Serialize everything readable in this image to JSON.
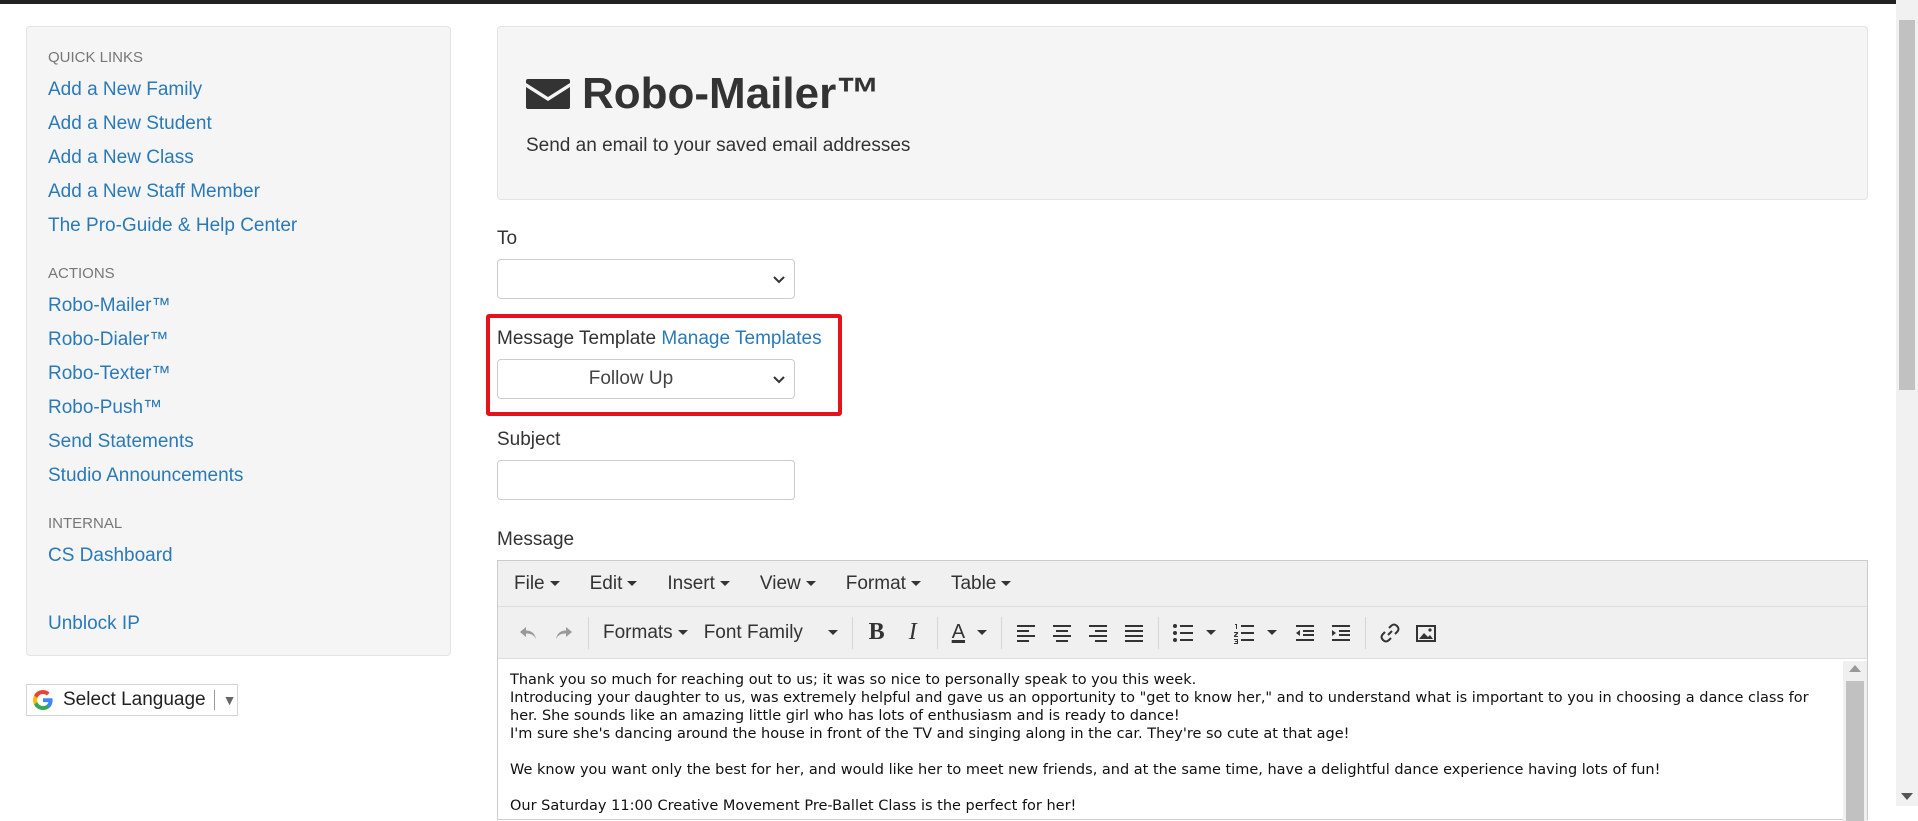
{
  "sidebar": {
    "sections": [
      {
        "heading": "QUICK LINKS",
        "links": [
          "Add a New Family",
          "Add a New Student",
          "Add a New Class",
          "Add a New Staff Member",
          "The Pro-Guide & Help Center"
        ]
      },
      {
        "heading": "ACTIONS",
        "links": [
          "Robo-Mailer™",
          "Robo-Dialer™",
          "Robo-Texter™",
          "Robo-Push™",
          "Send Statements",
          "Studio Announcements"
        ]
      },
      {
        "heading": "INTERNAL",
        "links": [
          "CS Dashboard"
        ]
      }
    ],
    "unblock": "Unblock IP"
  },
  "language": {
    "label": "Select Language",
    "arrow": "▼"
  },
  "header": {
    "title": "Robo-Mailer™",
    "subtitle": "Send an email to your saved email addresses"
  },
  "form": {
    "to_label": "To",
    "to_value": "",
    "template_label": "Message Template",
    "manage_link": "Manage Templates",
    "template_value": "Follow Up",
    "subject_label": "Subject",
    "subject_value": "",
    "message_label": "Message"
  },
  "editor": {
    "menus": [
      "File",
      "Edit",
      "Insert",
      "View",
      "Format",
      "Table"
    ],
    "toolbar": {
      "formats": "Formats",
      "font_family": "Font Family",
      "bold": "B",
      "italic": "I",
      "color": "A"
    },
    "content": [
      "Thank you so much for reaching out to us; it was so nice to personally speak to you this week.",
      "Introducing your daughter to us, was extremely helpful and gave us an opportunity to \"get to know her,\" and to understand what is important to you in choosing a dance class for her. She sounds like an amazing little girl who has lots of enthusiasm and is ready to dance!",
      "I'm sure she's dancing around the house in front of the TV and singing along in the car. They're so cute at that age!",
      "",
      "We know you want only the best for her, and would like her to meet new friends, and at the same time, have a delightful dance experience having lots of fun!",
      "",
      "Our Saturday 11:00 Creative Movement Pre-Ballet Class is the perfect for her!"
    ]
  },
  "colors": {
    "link": "#2a7ab8",
    "highlight": "#e3121b"
  }
}
